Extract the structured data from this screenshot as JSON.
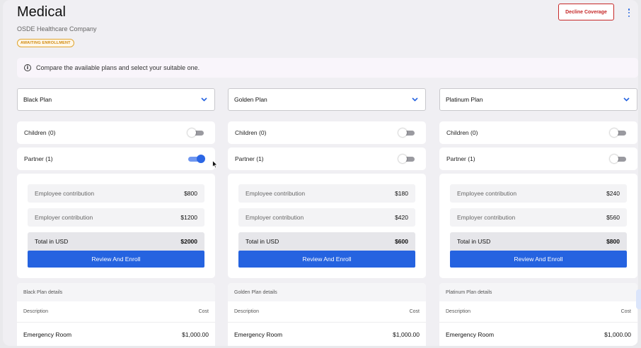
{
  "header": {
    "title": "Medical",
    "company": "OSDE Healthcare Company",
    "status_badge": "AWAITING ENROLLMENT",
    "decline_label": "Decline Coverage"
  },
  "info": {
    "icon": "info-icon",
    "text": "Compare the available plans and select your suitable one."
  },
  "colors": {
    "primary": "#2563e0",
    "danger": "#c62828",
    "badge": "#d08a10"
  },
  "plans": [
    {
      "name": "Black Plan",
      "children_label": "Children (0)",
      "children_on": false,
      "partner_label": "Partner (1)",
      "partner_on": true,
      "employee_label": "Employee contribution",
      "employee_amount": "$800",
      "employer_label": "Employer contribution",
      "employer_amount": "$1200",
      "total_label": "Total in USD",
      "total_amount": "$2000",
      "enroll_label": "Review And Enroll",
      "details_title": "Black Plan details",
      "desc_header": "Description",
      "cost_header": "Cost",
      "rows": [
        {
          "description": "Emergency Room",
          "cost": "$1,000.00"
        }
      ]
    },
    {
      "name": "Golden Plan",
      "children_label": "Children (0)",
      "children_on": false,
      "partner_label": "Partner (1)",
      "partner_on": false,
      "employee_label": "Employee contribution",
      "employee_amount": "$180",
      "employer_label": "Employer contribution",
      "employer_amount": "$420",
      "total_label": "Total in USD",
      "total_amount": "$600",
      "enroll_label": "Review And Enroll",
      "details_title": "Golden Plan details",
      "desc_header": "Description",
      "cost_header": "Cost",
      "rows": [
        {
          "description": "Emergency Room",
          "cost": "$1,000.00"
        }
      ]
    },
    {
      "name": "Platinum Plan",
      "children_label": "Children (0)",
      "children_on": false,
      "partner_label": "Partner (1)",
      "partner_on": false,
      "employee_label": "Employee contribution",
      "employee_amount": "$240",
      "employer_label": "Employer contribution",
      "employer_amount": "$560",
      "total_label": "Total in USD",
      "total_amount": "$800",
      "enroll_label": "Review And Enroll",
      "details_title": "Platinum Plan details",
      "desc_header": "Description",
      "cost_header": "Cost",
      "rows": [
        {
          "description": "Emergency Room",
          "cost": "$1,000.00"
        }
      ]
    }
  ]
}
